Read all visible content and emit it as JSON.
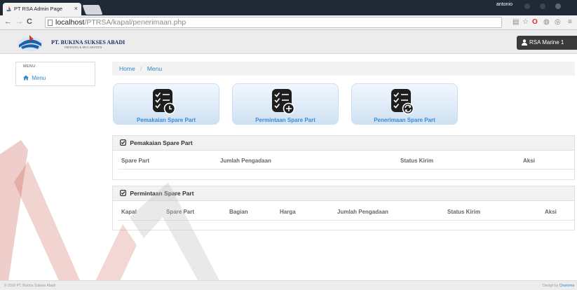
{
  "browser": {
    "tab_title": "PT RSA Admin Page",
    "user_label": "antonio",
    "url_host": "localhost",
    "url_path": "/PTRSA/kapal/penerimaan.php"
  },
  "header": {
    "company_name": "PT. BUKINA SUKSES ABADI",
    "company_tagline": "DREDGING & RECLAMATION",
    "user_menu_label": "RSA Marine 1"
  },
  "sidebar": {
    "heading": "MENU",
    "items": [
      {
        "label": "Menu",
        "icon": "home-icon"
      }
    ]
  },
  "breadcrumb": {
    "home": "Home",
    "separator": "/",
    "current": "Menu"
  },
  "tiles": [
    {
      "label": "Pemakaian Spare Part",
      "icon": "checklist-clock-icon"
    },
    {
      "label": "Permintaan Spare Part",
      "icon": "checklist-plus-icon"
    },
    {
      "label": "Penerimaan Spare Part",
      "icon": "checklist-refresh-icon"
    }
  ],
  "panels": {
    "pemakaian": {
      "title": "Pemakaian Spare Part",
      "columns": [
        "Spare Part",
        "Jumlah Pengadaan",
        "Status Kirim",
        "Aksi"
      ]
    },
    "permintaan": {
      "title": "Permintaan Spare Part",
      "columns": [
        "Kapal",
        "Spare Part",
        "Bagian",
        "Harga",
        "Jumlah Pengadaan",
        "Status Kirim",
        "Aksi"
      ]
    }
  },
  "footer": {
    "copyright": "© 2016 PT. Bukina Sukses Abadi",
    "design_prefix": "Design by",
    "design_link": "Charisma"
  },
  "colors": {
    "accent": "#2f87c8",
    "tile_label": "#3b8ad4",
    "dark_bar": "#1f2a36",
    "watermark": "#c0392b"
  }
}
